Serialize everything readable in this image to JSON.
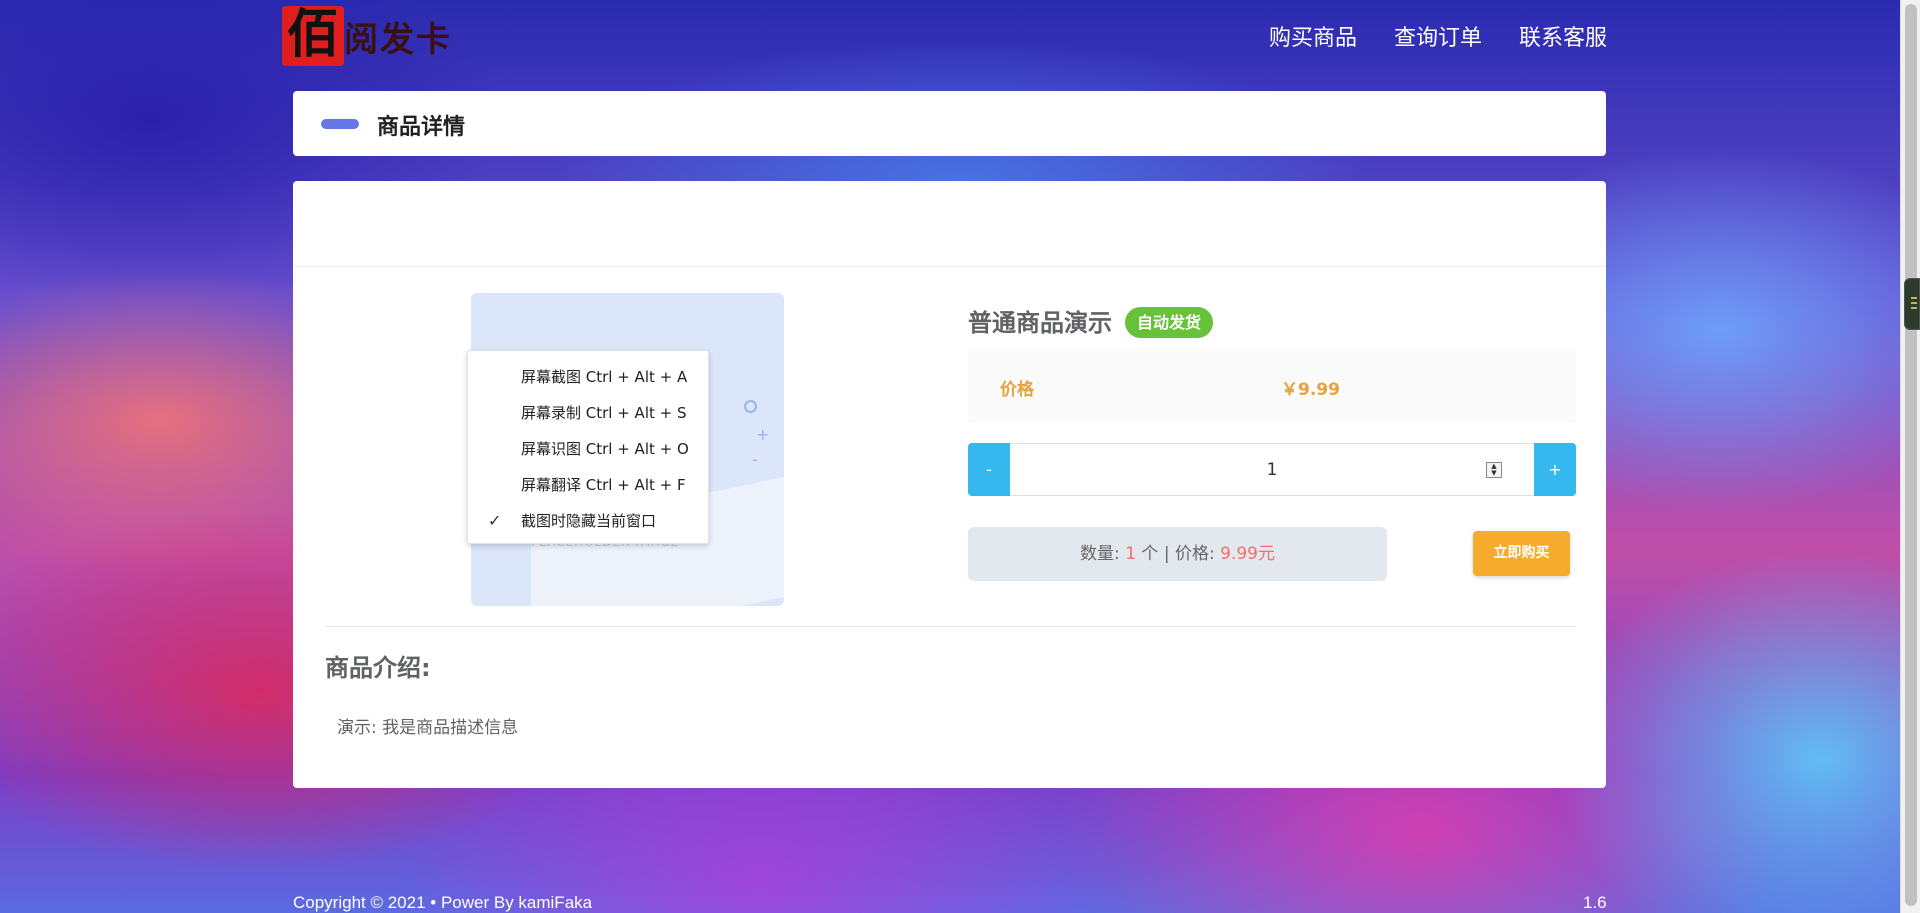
{
  "logo": {
    "mark": "佰",
    "text": "阅发卡"
  },
  "nav": {
    "items": [
      "购买商品",
      "查询订单",
      "联系客服"
    ]
  },
  "page_title": "商品详情",
  "product": {
    "name": "普通商品演示",
    "delivery_badge": "自动发货",
    "price_label": "价格",
    "price_value": "￥9.99",
    "quantity": "1",
    "minus_label": "-",
    "plus_label": "+",
    "summary": {
      "qty_prefix": "数量: ",
      "qty_value": "1",
      "qty_unit": " 个 | 价格: ",
      "price_value": "9.99元"
    },
    "buy_label": "立即购买",
    "image_placeholder_text": "PLACEHOLDER IMAGE"
  },
  "context_menu": {
    "items": [
      "屏幕截图 Ctrl + Alt + A",
      "屏幕录制 Ctrl + Alt + S",
      "屏幕识图 Ctrl + Alt + O",
      "屏幕翻译 Ctrl + Alt + F",
      "截图时隐藏当前窗口"
    ],
    "checked_item": "截图时隐藏当前窗口"
  },
  "description": {
    "title": "商品介绍:",
    "text": "演示: 我是商品描述信息"
  },
  "footer": {
    "copyright": "Copyright © 2021 •  Power By kamiFaka",
    "version": "1.6"
  },
  "colors": {
    "accent_blue": "#35b8ee",
    "badge_green": "#67c23a",
    "price_orange": "#e6a23c",
    "buy_orange": "#f7ab2c",
    "highlight_red": "#f56c6c",
    "title_bar": "#6676e6"
  }
}
